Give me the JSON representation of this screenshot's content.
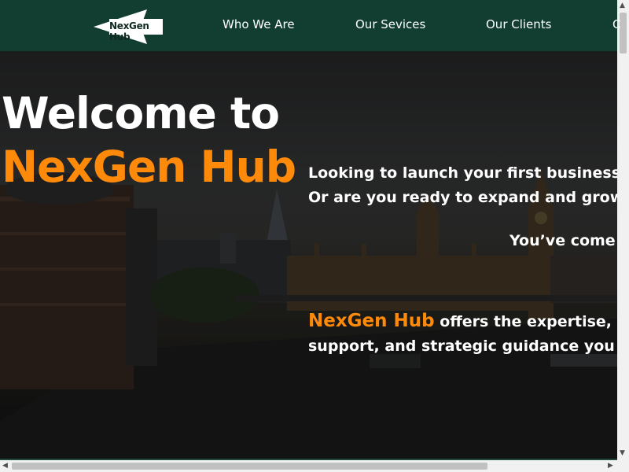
{
  "header": {
    "logo_text": "NexGen Hub",
    "nav": [
      "Who We Are",
      "Our Sevices",
      "Our Clients",
      "C"
    ]
  },
  "hero": {
    "welcome": "Welcome to",
    "brand": "NexGen Hub",
    "line1": "Looking to launch your first business",
    "line2": "Or are you ready to expand and grow",
    "line3": "You’ve come",
    "brand_inline": "NexGen Hub",
    "line4": "offers the expertise, l",
    "line5": "support, and strategic guidance you"
  },
  "colors": {
    "header_bg": "#123e32",
    "accent": "#ff8a0a",
    "text": "#ffffff"
  },
  "icons": {
    "logo": "nexgen-hub-arrow-logo",
    "scroll_up": "triangle-up",
    "scroll_down": "triangle-down",
    "scroll_left": "triangle-left",
    "scroll_right": "triangle-right"
  }
}
